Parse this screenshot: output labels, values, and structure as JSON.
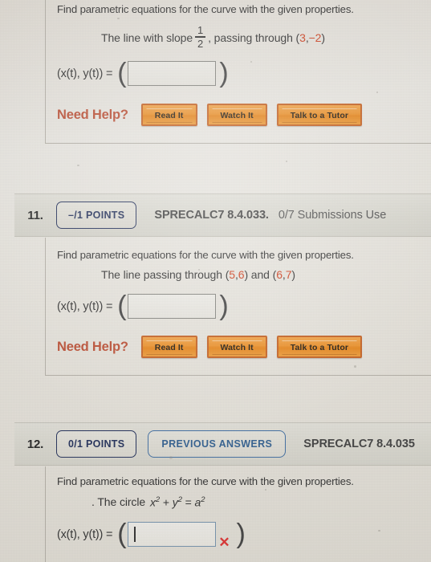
{
  "problems": [
    {
      "number": "",
      "prompt": "Find parametric equations for the curve with the given properties.",
      "detail_pre": "The line with slope",
      "frac_numer": "1",
      "frac_denom": "2",
      "detail_mid": ", passing through (",
      "point_a": "3",
      "detail_comma": ", ",
      "point_b": "−2",
      "detail_post": ")",
      "answer_label": "(x(t), y(t))  =",
      "answer_value": "",
      "help_label": "Need Help?",
      "help_buttons": [
        "Read It",
        "Watch It",
        "Talk to a Tutor"
      ]
    },
    {
      "number": "11.",
      "points_badge": "–/1 POINTS",
      "source": "SPRECALC7 8.4.033.",
      "submissions": "0/7 Submissions Use",
      "prompt": "Find parametric equations for the curve with the given properties.",
      "detail_pre": "The line passing through (",
      "point_a": "5",
      "detail_comma": ", ",
      "point_b": "6",
      "detail_mid": ") and (",
      "point_c": "6",
      "point_d": "7",
      "detail_post": ")",
      "answer_label": "(x(t), y(t))  =",
      "answer_value": "",
      "help_label": "Need Help?",
      "help_buttons": [
        "Read It",
        "Watch It",
        "Talk to a Tutor"
      ]
    },
    {
      "number": "12.",
      "points_badge": "0/1 POINTS",
      "previous_answers": "PREVIOUS ANSWERS",
      "source": "SPRECALC7 8.4.035",
      "prompt": "Find parametric equations for the curve with the given properties.",
      "detail_pre": ". The circle",
      "equation_x": "x",
      "equation_x_exp": "2",
      "equation_plus": "+",
      "equation_y": "y",
      "equation_y_exp": "2",
      "equation_eq": "=",
      "equation_a": "a",
      "equation_a_exp": "2",
      "answer_label": "(x(t), y(t))  =",
      "answer_value": "",
      "incorrect_mark": "✕"
    }
  ],
  "colors": {
    "accent_orange": "#c0563c",
    "number_highlight": "#d24a2b",
    "badge_navy": "#2d3a63",
    "prev_answers_blue": "#3c6897",
    "incorrect_red": "#e03b3b",
    "button_orange": "#ef9733"
  }
}
